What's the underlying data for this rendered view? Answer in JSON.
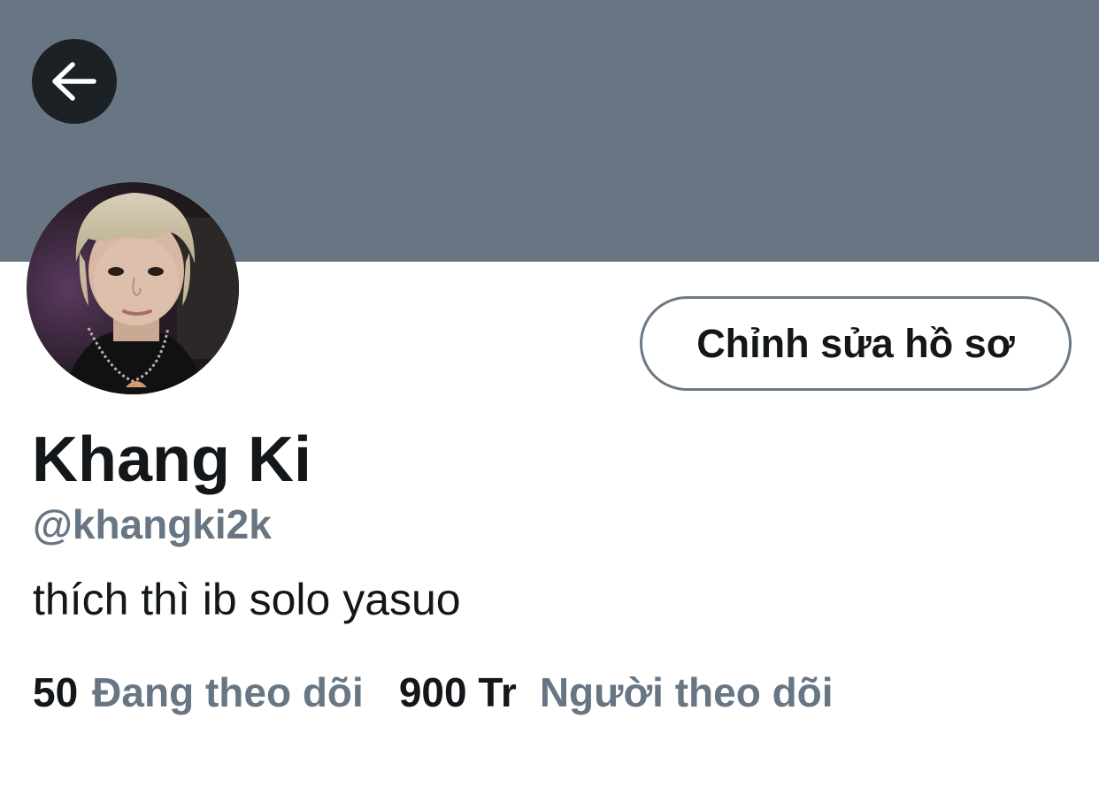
{
  "header": {
    "back_icon": "arrow-left-icon",
    "banner_color": "#687684"
  },
  "profile": {
    "avatar_icon": "profile-photo",
    "edit_button_label": "Chỉnh sửa hồ sơ",
    "display_name": "Khang Ki",
    "handle": "@khangki2k",
    "bio": "thích thì ib solo yasuo"
  },
  "stats": {
    "following_count": "50",
    "following_label": "Đang theo dõi",
    "followers_count": "900 Tr",
    "followers_label": "Người theo dõi"
  },
  "colors": {
    "text_primary": "#14171a",
    "text_secondary": "#687684",
    "button_border": "#6b7885"
  }
}
